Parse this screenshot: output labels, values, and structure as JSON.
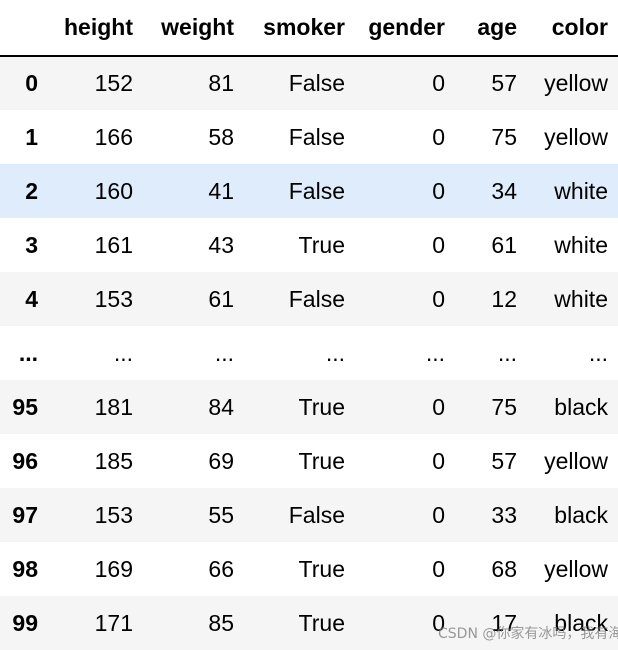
{
  "table": {
    "columns": [
      "",
      "height",
      "weight",
      "smoker",
      "gender",
      "age",
      "color"
    ],
    "rows": [
      {
        "index": "0",
        "cells": [
          "152",
          "81",
          "False",
          "0",
          "57",
          "yellow"
        ]
      },
      {
        "index": "1",
        "cells": [
          "166",
          "58",
          "False",
          "0",
          "75",
          "yellow"
        ]
      },
      {
        "index": "2",
        "cells": [
          "160",
          "41",
          "False",
          "0",
          "34",
          "white"
        ],
        "highlighted": true
      },
      {
        "index": "3",
        "cells": [
          "161",
          "43",
          "True",
          "0",
          "61",
          "white"
        ]
      },
      {
        "index": "4",
        "cells": [
          "153",
          "61",
          "False",
          "0",
          "12",
          "white"
        ]
      },
      {
        "index": "...",
        "cells": [
          "...",
          "...",
          "...",
          "...",
          "...",
          "..."
        ]
      },
      {
        "index": "95",
        "cells": [
          "181",
          "84",
          "True",
          "0",
          "75",
          "black"
        ]
      },
      {
        "index": "96",
        "cells": [
          "185",
          "69",
          "True",
          "0",
          "57",
          "yellow"
        ]
      },
      {
        "index": "97",
        "cells": [
          "153",
          "55",
          "False",
          "0",
          "33",
          "black"
        ]
      },
      {
        "index": "98",
        "cells": [
          "169",
          "66",
          "True",
          "0",
          "68",
          "yellow"
        ]
      },
      {
        "index": "99",
        "cells": [
          "171",
          "85",
          "True",
          "0",
          "17",
          "black"
        ]
      }
    ]
  },
  "watermark": "CSDN @你家有冰吗，我有海",
  "colors": {
    "stripe": "#f5f5f5",
    "highlight": "#dfecfb",
    "border": "#000000"
  }
}
